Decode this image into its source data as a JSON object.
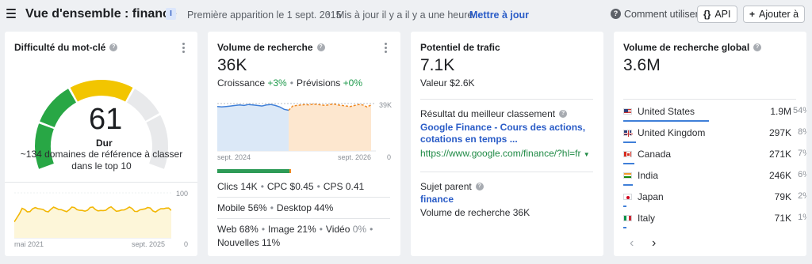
{
  "header": {
    "title": "Vue d'ensemble : finance",
    "info_badge": "I",
    "first_seen": "Première apparition le 1 sept. 2015",
    "updated": "Mis à jour il y a il y a une heure",
    "update_link": "Mettre à jour",
    "help": "Comment utiliser",
    "api_label": "API",
    "add_label": "Ajouter à"
  },
  "difficulty": {
    "title": "Difficulté du mot-clé",
    "value": "61",
    "value_fraction": 0.61,
    "level": "Dur",
    "description": "~134 domaines de référence à classer dans le top 10",
    "chart": {
      "x_start": "mai 2021",
      "x_end": "sept. 2025",
      "y_max": "100",
      "y_min": "0"
    },
    "colors": {
      "red": "#e03a34",
      "orange": "#f29b30",
      "yellow": "#f2c500",
      "green": "#28a745",
      "gray": "#e8e9eb",
      "line": "#f2b705"
    }
  },
  "search_volume": {
    "title": "Volume de recherche",
    "value": "36K",
    "growth_label": "Croissance",
    "growth_value": "+3%",
    "forecast_label": "Prévisions",
    "forecast_value": "+0%",
    "chart": {
      "x_start": "sept. 2024",
      "x_end": "sept. 2026",
      "y_max": "39K",
      "y_min": "0"
    },
    "intent_bar": {
      "green_fraction": 0.97,
      "orange_fraction": 0.01,
      "colors": [
        "#2e9b57",
        "#f08a24",
        "#3f7fd8"
      ]
    },
    "clicks": "Clics 14K",
    "cpc": "CPC $0.45",
    "cps": "CPS 0.41",
    "mobile": "Mobile 56%",
    "desktop": "Desktop 44%",
    "web": "Web 68%",
    "image": "Image 21%",
    "video_label": "Vidéo",
    "video_value": "0%",
    "news": "Nouvelles 11%"
  },
  "traffic": {
    "title": "Potentiel de trafic",
    "value": "7.1K",
    "value_label": "Valeur $2.6K",
    "best_rank_label": "Résultat du meilleur classement",
    "best_rank_title": "Google Finance - Cours des actions, cotations en temps ...",
    "best_rank_url": "https://www.google.com/finance/?hl=fr",
    "parent_label": "Sujet parent",
    "parent_topic": "finance",
    "parent_volume": "Volume de recherche 36K"
  },
  "global_volume": {
    "title": "Volume de recherche global",
    "value": "3.6M",
    "countries": [
      {
        "name": "United States",
        "value": "1.9M",
        "pct": "54%",
        "share": 0.54,
        "flag": "us-flag"
      },
      {
        "name": "United Kingdom",
        "value": "297K",
        "pct": "8%",
        "share": 0.08,
        "flag": "uk-flag"
      },
      {
        "name": "Canada",
        "value": "271K",
        "pct": "7%",
        "share": 0.07,
        "flag": "ca-flag"
      },
      {
        "name": "India",
        "value": "246K",
        "pct": "6%",
        "share": 0.06,
        "flag": "in-flag"
      },
      {
        "name": "Japan",
        "value": "79K",
        "pct": "2%",
        "share": 0.02,
        "flag": "jp-flag"
      },
      {
        "name": "Italy",
        "value": "71K",
        "pct": "1%",
        "share": 0.01,
        "flag": "it-flag"
      }
    ],
    "prev": "‹",
    "next": "›"
  }
}
